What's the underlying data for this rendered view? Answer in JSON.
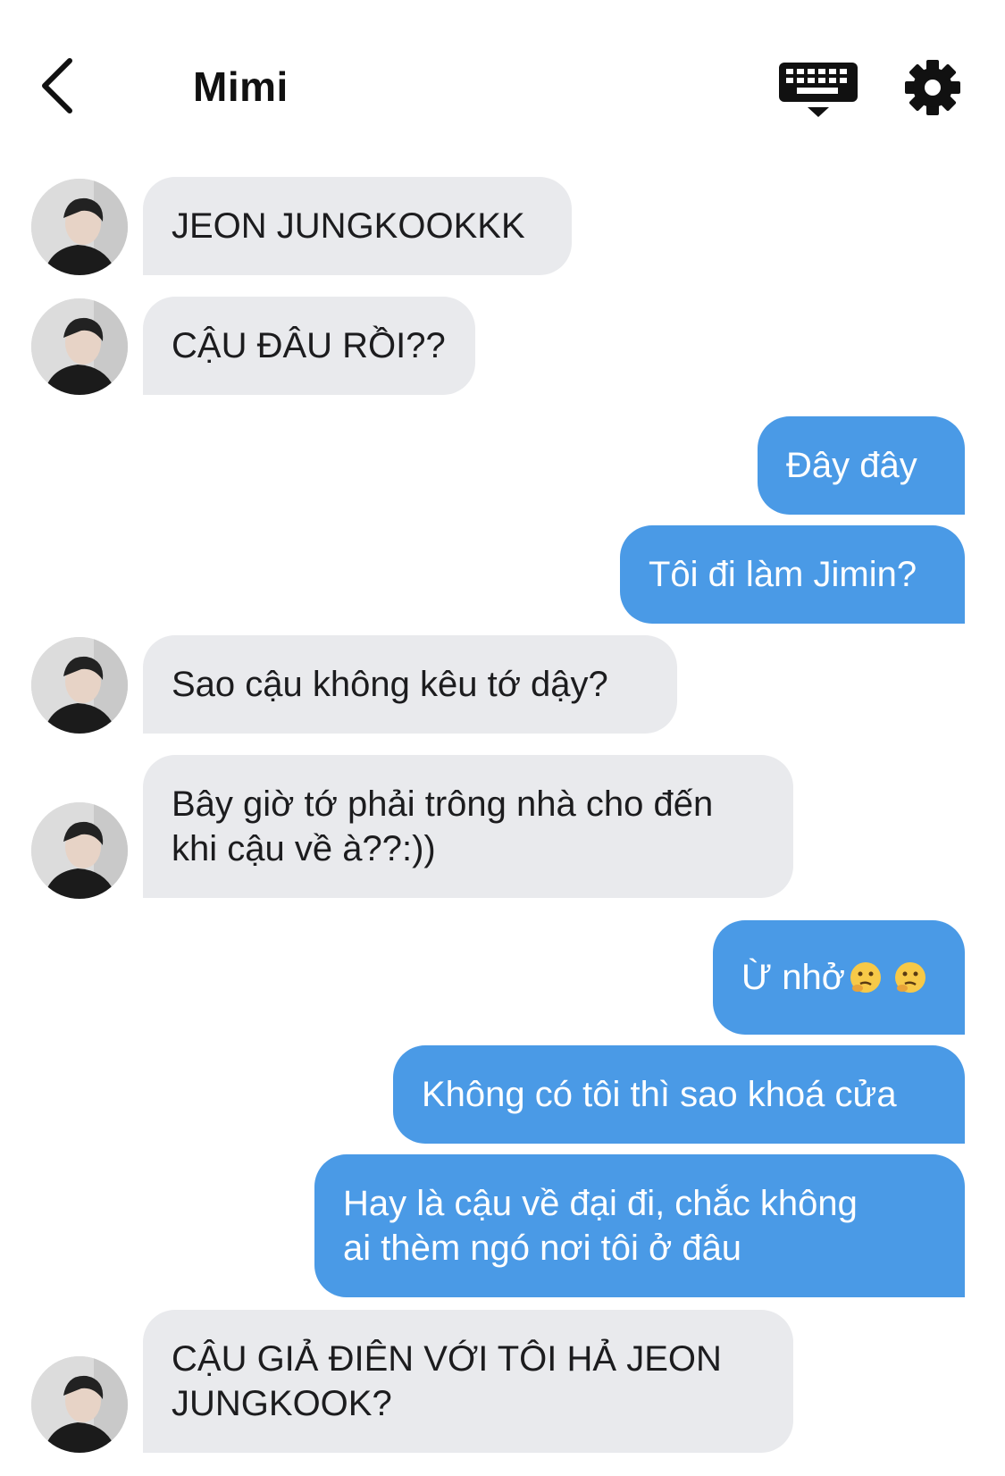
{
  "header": {
    "title": "Mimi",
    "back_icon": "chevron-left-icon",
    "keyboard_icon": "keyboard-icon",
    "settings_icon": "gear-icon"
  },
  "colors": {
    "incoming_bubble": "#e9eaed",
    "outgoing_bubble": "#4a9ae6",
    "outgoing_text": "#ffffff"
  },
  "messages": [
    {
      "from": "other",
      "text": "JEON JUNGKOOKKK"
    },
    {
      "from": "other",
      "text": "CẬU ĐÂU RỒI??"
    },
    {
      "from": "me",
      "text": "Đây đây"
    },
    {
      "from": "me",
      "text": "Tôi đi làm Jimin?"
    },
    {
      "from": "other",
      "text": "Sao cậu không kêu tớ dậy?"
    },
    {
      "from": "other",
      "text": "Bây giờ tớ phải trông nhà cho đến\nkhi cậu về à??:))"
    },
    {
      "from": "me",
      "text": "Ừ nhở",
      "emoji": "thinking-face-icon"
    },
    {
      "from": "me",
      "text": "Không có tôi thì sao khoá cửa"
    },
    {
      "from": "me",
      "text": "Hay là cậu về đại đi, chắc không\nai thèm ngó nơi tôi ở đâu"
    },
    {
      "from": "other",
      "text": "CẬU GIẢ ĐIÊN VỚI TÔI HẢ JEON\nJUNGKOOK?"
    }
  ]
}
